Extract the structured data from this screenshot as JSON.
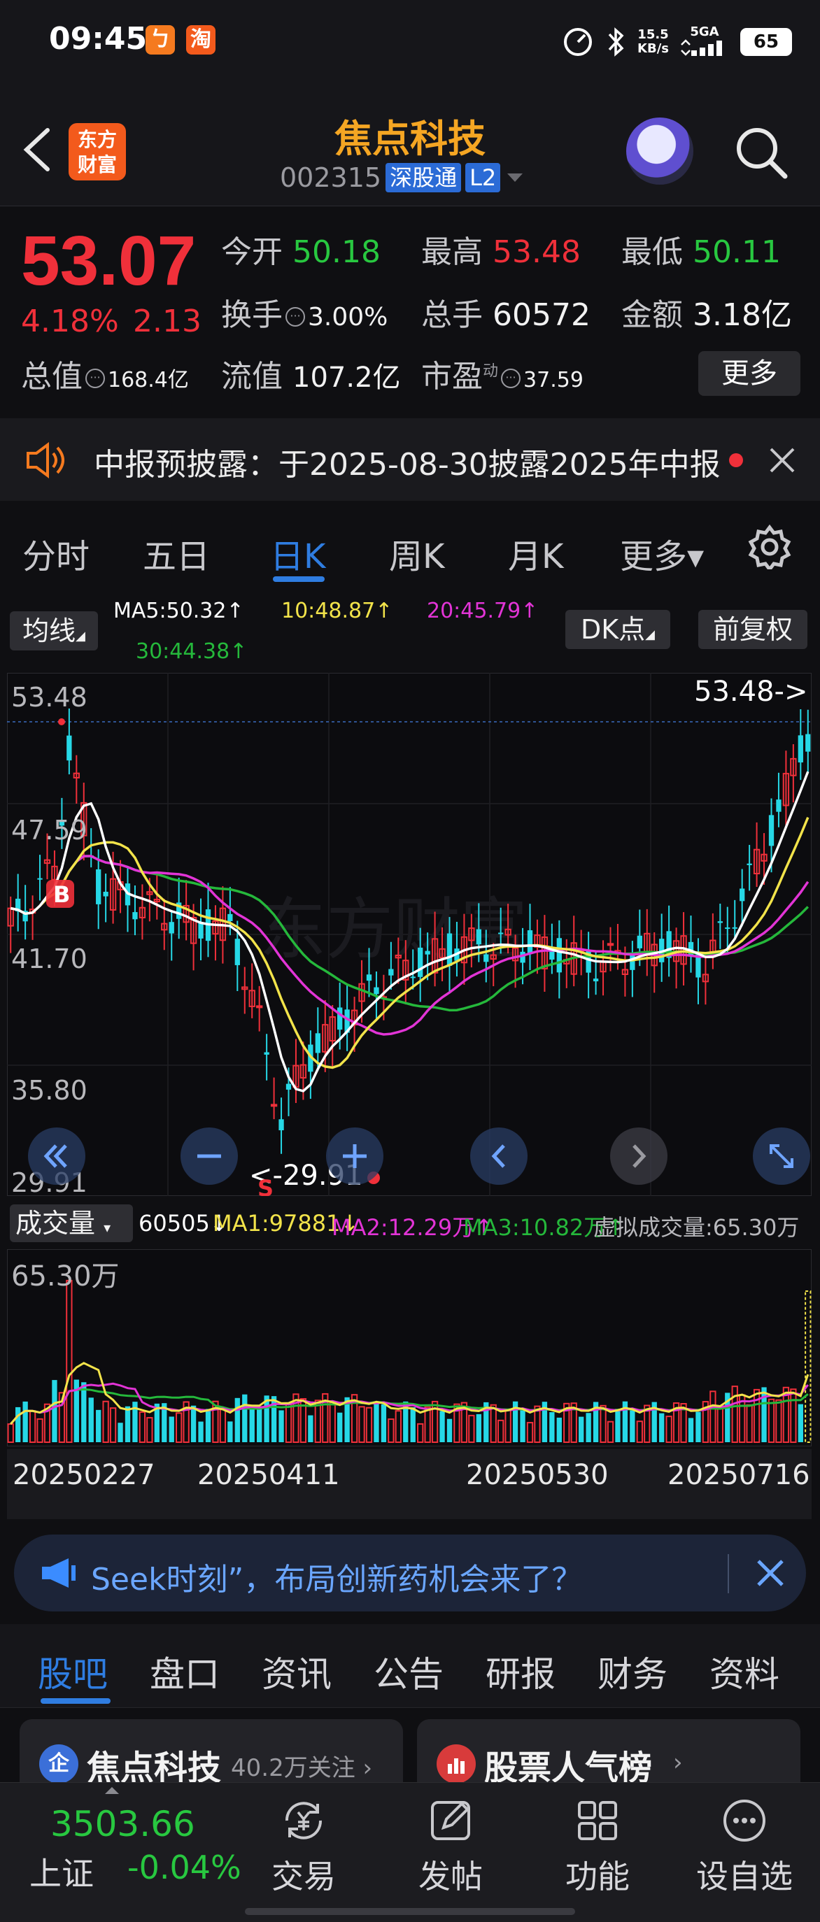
{
  "status_bar": {
    "time": "09:45",
    "app_badge_1": "ㄅ",
    "app_badge_2": "淘",
    "net_speed_value": "15.5",
    "net_speed_unit": "KB/s",
    "network": "5GA",
    "battery": "65"
  },
  "header": {
    "logo_line1": "东方",
    "logo_line2": "财富",
    "stock_name": "焦点科技",
    "stock_code": "002315",
    "tag_connect": "深股通",
    "tag_level": "L2"
  },
  "quote": {
    "price": "53.07",
    "change_pct": "4.18%",
    "change_amt": "2.13",
    "open_label": "今开",
    "open_value": "50.18",
    "high_label": "最高",
    "high_value": "53.48",
    "low_label": "最低",
    "low_value": "50.11",
    "turnover_label": "换手",
    "turnover_value": "3.00%",
    "volume_label": "总手",
    "volume_value": "60572",
    "amount_label": "金额",
    "amount_value": "3.18亿",
    "mktcap_label": "总值",
    "mktcap_value": "168.4亿",
    "float_label": "流值",
    "float_value": "107.2亿",
    "pe_label": "市盈",
    "pe_sup": "动",
    "pe_value": "37.59",
    "more_label": "更多"
  },
  "notice": {
    "text": "中报预披露：于2025-08-30披露2025年中报"
  },
  "period_tabs": [
    {
      "label": "分时",
      "active": false
    },
    {
      "label": "五日",
      "active": false
    },
    {
      "label": "日K",
      "active": true
    },
    {
      "label": "周K",
      "active": false
    },
    {
      "label": "月K",
      "active": false
    },
    {
      "label": "更多▾",
      "active": false
    }
  ],
  "ma_legend": {
    "indicator_btn": "均线",
    "ma5": "MA5:50.32↑",
    "ma10": "10:48.87↑",
    "ma20": "20:45.79↑",
    "ma30": "30:44.38↑",
    "dk_btn": "DK点",
    "adjust_btn": "前复权"
  },
  "kline": {
    "y_labels": [
      "53.48",
      "47.59",
      "41.70",
      "35.80",
      "29.91"
    ],
    "max_marker": "53.48->",
    "min_marker": "<-29.91",
    "buy_marker": "B",
    "sell_marker": "S",
    "watermark": "东方财富"
  },
  "volume": {
    "indicator_btn": "成交量",
    "vol": "60505↓",
    "ma1": "MA1:97881↓",
    "ma2": "MA2:12.29万↑",
    "ma3": "MA3:10.82万↑",
    "virtual": "虚拟成交量:65.30万",
    "max_label": "65.30万"
  },
  "dates": [
    "20250227",
    "20250411",
    "20250530",
    "20250716"
  ],
  "banner": {
    "text": "Seek时刻”，布局创新药机会来了？"
  },
  "sub_tabs": [
    "股吧",
    "盘口",
    "资讯",
    "公告",
    "研报",
    "财务",
    "资料"
  ],
  "cards": {
    "card1_icon": "企",
    "card1_title": "焦点科技",
    "card1_meta": "40.2万关注 ›",
    "card2_title": "股票人气榜",
    "card2_meta": "›"
  },
  "bottom_nav": {
    "index_value": "3503.66",
    "index_name": "上证",
    "index_change": "-0.04%",
    "items": [
      "交易",
      "发帖",
      "功能",
      "设自选"
    ]
  },
  "colors": {
    "up": "#f0303a",
    "down": "#28c840",
    "candle_down": "#26d8e6",
    "ma5": "#ffffff",
    "ma10": "#f2e34a",
    "ma20": "#e234d6",
    "ma30": "#25b83b",
    "accent": "#2f7de1"
  }
}
